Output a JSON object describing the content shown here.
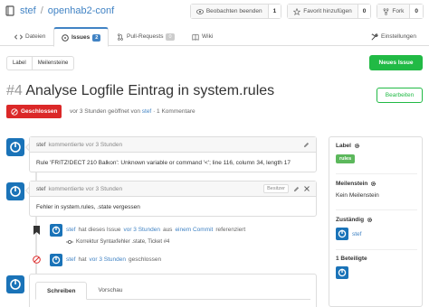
{
  "repo": {
    "owner": "stef",
    "separator": "/",
    "name": "openhab2-conf"
  },
  "repo_buttons": [
    {
      "label": "Beobachten beenden",
      "count": "1",
      "icon": "eye-icon"
    },
    {
      "label": "Favorit hinzufügen",
      "count": "0",
      "icon": "star-icon"
    },
    {
      "label": "Fork",
      "count": "0",
      "icon": "fork-icon"
    }
  ],
  "tabs": {
    "files": "Dateien",
    "issues": "Issues",
    "issues_count": "2",
    "pulls": "Pull-Requests",
    "pulls_count": "0",
    "wiki": "Wiki",
    "settings": "Einstellungen"
  },
  "filters": {
    "label": "Label",
    "milestones": "Meilensteine"
  },
  "new_issue": "Neues Issue",
  "issue": {
    "number": "#4",
    "title": "Analyse Logfile Eintrag in system.rules",
    "edit": "Bearbeiten",
    "status": "Geschlossen",
    "meta_prefix": "vor 3 Stunden geöffnet von",
    "meta_author": "stef",
    "meta_suffix": "· 1 Kommentare"
  },
  "comments": [
    {
      "author": "stef",
      "action": "kommentierte",
      "time": "vor 3 Stunden",
      "body": "Rule 'FRITZ!DECT 210 Balkon': Unknown variable or command '<'; line 116, column 34, length 17"
    },
    {
      "author": "stef",
      "action": "kommentierte",
      "time": "vor 3 Stunden",
      "role": "Besitzer",
      "body": "Fehler in system.rules, .state vergessen"
    }
  ],
  "events": {
    "ref_author": "stef",
    "ref_text": "hat dieses Issue",
    "ref_time": "vor 3 Stunden",
    "ref_text2": "aus",
    "ref_link": "einem Commit",
    "ref_text3": "referenziert",
    "commit_msg": "Korrektur Syntaxfehler .state, Ticket #4",
    "close_author": "stef",
    "close_text": "hat",
    "close_time": "vor 3 Stunden",
    "close_action": "geschlossen"
  },
  "editor": {
    "write": "Schreiben",
    "preview": "Vorschau"
  },
  "sidebar": {
    "labels_title": "Label",
    "label_value": "rules",
    "label_color": "#5cb85c",
    "milestone_title": "Meilenstein",
    "milestone_value": "Kein Meilenstein",
    "assignee_title": "Zuständig",
    "assignee_value": "stef",
    "participants_title": "1 Beteiligte"
  },
  "colors": {
    "accent": "#4183c4",
    "success": "#21ba45",
    "danger": "#db2828",
    "avatar": "#1a73b8"
  }
}
